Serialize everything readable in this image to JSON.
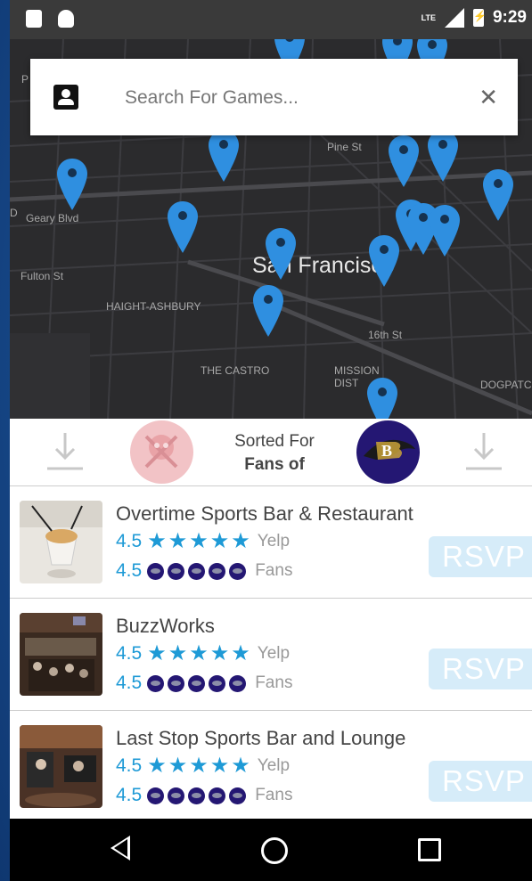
{
  "status_bar": {
    "network": "LTE",
    "time": "9:29"
  },
  "map": {
    "labels": {
      "pine_st": "Pine St",
      "geary_blvd": "Geary Blvd",
      "fulton_st": "Fulton St",
      "haight_ashbury": "HAIGHT-ASHBURY",
      "san_francisco": "San Francisco",
      "sixteenth_st": "16th St",
      "the_castro": "THE CASTRO",
      "mission_district": "MISSION\nDIST",
      "dogpatch": "DOGPATC",
      "p_edge": "P",
      "d_edge": "D"
    },
    "pin_color": "#2f8fe0"
  },
  "search": {
    "placeholder": "Search For Games..."
  },
  "sort": {
    "line1": "Sorted For",
    "line2": "Fans of"
  },
  "venues": [
    {
      "name": "Overtime Sports Bar & Restaurant",
      "yelp_rating": "4.5",
      "fan_rating": "4.5",
      "yelp_label": "Yelp",
      "fans_label": "Fans",
      "rsvp_label": "RSVP"
    },
    {
      "name": "BuzzWorks",
      "yelp_rating": "4.5",
      "fan_rating": "4.5",
      "yelp_label": "Yelp",
      "fans_label": "Fans",
      "rsvp_label": "RSVP"
    },
    {
      "name": "Last Stop Sports Bar and Lounge",
      "yelp_rating": "4.5",
      "fan_rating": "4.5",
      "yelp_label": "Yelp",
      "fans_label": "Fans",
      "rsvp_label": "RSVP"
    }
  ],
  "colors": {
    "accent": "#1e9ad6",
    "rsvp_bg": "#d6ecf9",
    "ravens_purple": "#241773",
    "bucs_red": "#f2c3c6"
  },
  "icons": {
    "contact": "contact-card-icon",
    "close": "close-icon",
    "sort_arrow": "arrow-down-icon",
    "star": "star-icon",
    "team": "ravens-logo-icon"
  }
}
